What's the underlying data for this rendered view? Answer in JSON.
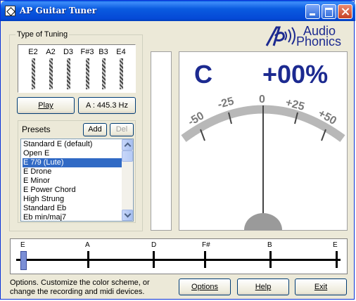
{
  "window": {
    "title": "AP Guitar Tuner"
  },
  "tuning": {
    "group_label": "Type of Tuning",
    "strings": [
      "E2",
      "A2",
      "D3",
      "F#3",
      "B3",
      "E4"
    ],
    "play_label": "Play",
    "pitch_label": "A : 445.3 Hz"
  },
  "presets": {
    "label": "Presets",
    "add_label": "Add",
    "del_label": "Del",
    "items": [
      "Standard E (default)",
      "Open E",
      "E 7/9 (Lute)",
      "E Drone",
      "E Minor",
      "E Power Chord",
      "High Strung",
      "Standard Eb",
      "Eb min/maj7"
    ],
    "selected_index": 2
  },
  "logo": {
    "line1": "Audio",
    "line2": "Phonics"
  },
  "display": {
    "note": "C",
    "cents": "+00%",
    "scale": [
      "-50",
      "-25",
      "0",
      "+25",
      "+50"
    ],
    "needle_value": 0
  },
  "strobe": {
    "notes": [
      "E",
      "A",
      "D",
      "F#",
      "B",
      "E"
    ]
  },
  "footer": {
    "info": "Options.  Customize the color scheme, or change the recording and midi devices.",
    "options_label": "Options",
    "help_label": "Help",
    "exit_label": "Exit"
  },
  "colors": {
    "accent": "#1c2a90",
    "title_bar": "#0a5be0",
    "selection": "#316ac5"
  }
}
